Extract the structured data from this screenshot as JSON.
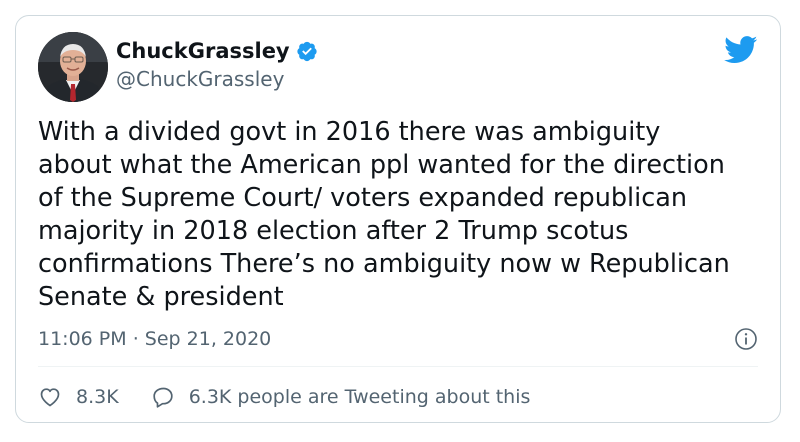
{
  "author": {
    "display_name": "ChuckGrassley",
    "handle": "@ChuckGrassley"
  },
  "tweet": {
    "text": "With a divided govt in 2016 there was ambiguity\nabout what the American ppl wanted for the direction\nof the Supreme Court/ voters expanded republican\nmajority in 2018 election after 2 Trump scotus\nconfirmations There’s no ambiguity now w Republican\nSenate & president",
    "time": "11:06 PM",
    "separator": "·",
    "date": "Sep 21, 2020"
  },
  "actions": {
    "likes": "8.3K",
    "replies_text": "6.3K people are Tweeting about this"
  },
  "icons": {
    "verified": "verified-badge-icon",
    "platform": "twitter-bird-icon",
    "info": "info-icon",
    "like": "heart-icon",
    "reply": "speech-bubble-icon"
  },
  "colors": {
    "accent": "#1d9bf0",
    "text": "#0f1419",
    "secondary": "#536471",
    "border": "#cfd9de"
  }
}
